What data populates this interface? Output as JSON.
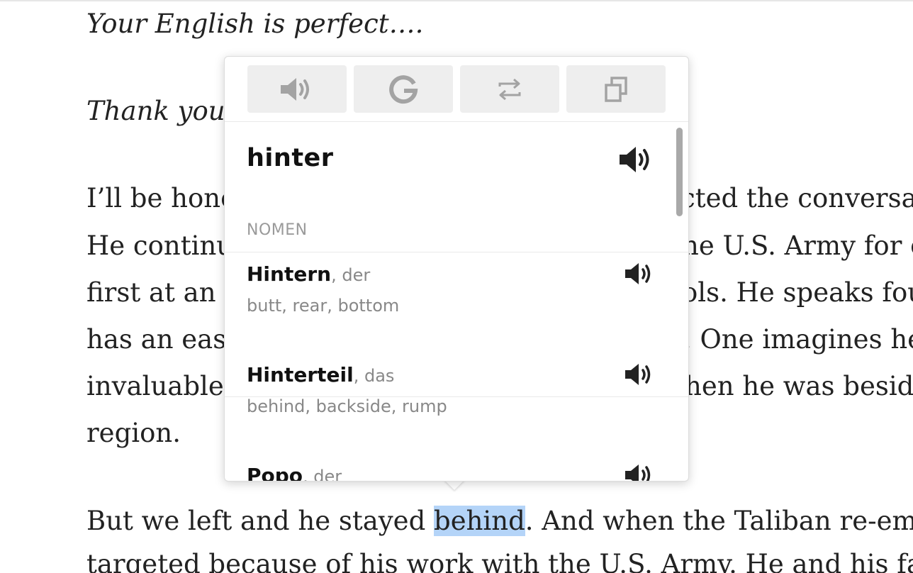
{
  "article": {
    "lines": [
      "Your English is perfect….",
      "Thank you.",
      "I’ll be hone",
      "cted the conversa",
      "He continu",
      "he U.S. Army for e",
      "first at an a",
      "ols. He speaks fou",
      "has an easy",
      ". One imagines he",
      "invaluable",
      "hen he was besid",
      "region.",
      "But we left and he stayed ",
      "behind",
      ". And when the Taliban re-emer",
      "targeted because of his work with the U.S. Army. He and his fam"
    ]
  },
  "popup": {
    "toolbar": {
      "speak_icon": "speaker-icon",
      "google_icon": "google-icon",
      "swap_icon": "swap-arrows-icon",
      "copy_icon": "copy-icon"
    },
    "headword": "hinter",
    "part_of_speech": "NOMEN",
    "entries": [
      {
        "word": "Hintern",
        "gender": ", der",
        "translations": "butt, rear, bottom"
      },
      {
        "word": "Hinterteil",
        "gender": ", das",
        "translations": "behind, backside, rump"
      },
      {
        "word": "Popo",
        "gender": ", der",
        "translations": ""
      }
    ]
  },
  "colors": {
    "highlight": "#b4d4f8",
    "toolbar_button": "#eeeeee",
    "icon_gray": "#9e9e9e"
  }
}
